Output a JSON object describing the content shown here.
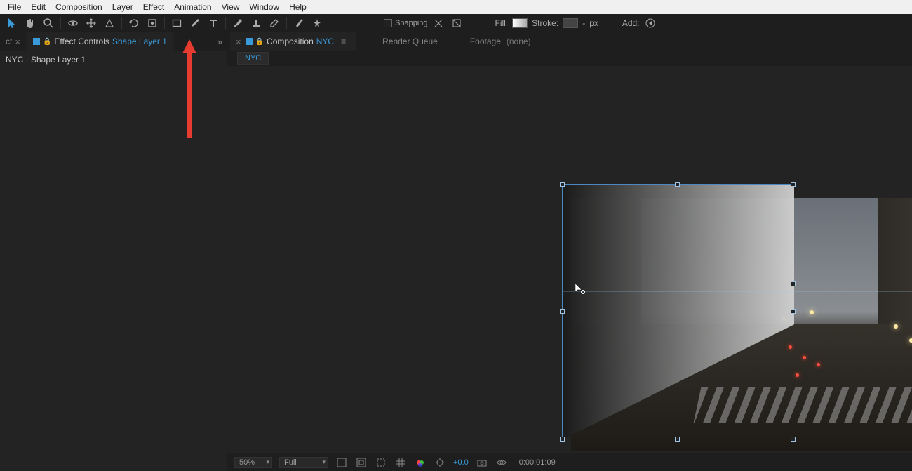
{
  "menu": {
    "items": [
      "File",
      "Edit",
      "Composition",
      "Layer",
      "Effect",
      "Animation",
      "View",
      "Window",
      "Help"
    ]
  },
  "toolbar": {
    "snapping_label": "Snapping",
    "fill_label": "Fill:",
    "stroke_label": "Stroke:",
    "stroke_size": "-",
    "stroke_unit": "px",
    "add_label": "Add:"
  },
  "left_panel": {
    "tab_prefix": "ct",
    "effect_controls_label": "Effect Controls",
    "layer_name": "Shape Layer 1",
    "breadcrumb": "NYC · Shape Layer 1"
  },
  "right_panel": {
    "composition_label": "Composition",
    "composition_name": "NYC",
    "render_queue_label": "Render Queue",
    "footage_label": "Footage",
    "footage_value": "(none)",
    "chip": "NYC"
  },
  "viewer_footer": {
    "zoom": "50%",
    "resolution": "Full",
    "exposure": "+0.0",
    "timecode": "0:00:01:09"
  },
  "colors": {
    "accent_blue": "#3a9ad9",
    "panel_bg": "#232323",
    "arrow_red": "#e63b2e"
  }
}
